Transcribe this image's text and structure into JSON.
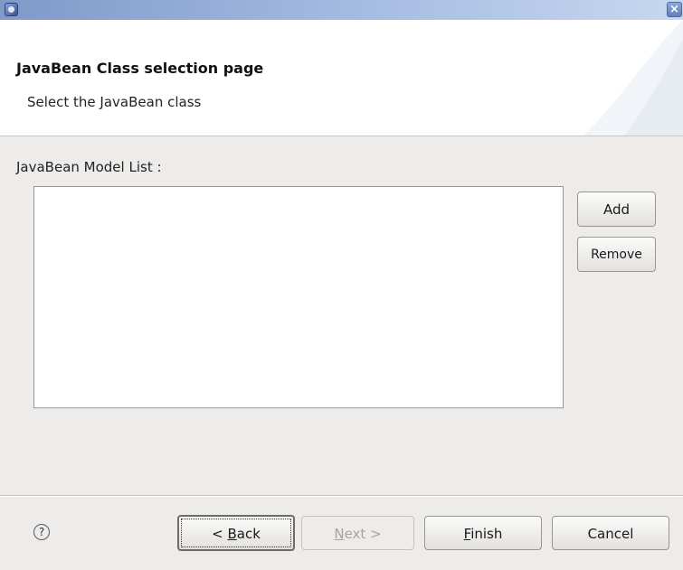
{
  "window": {
    "app_icon": "eclipse-icon",
    "close_icon": "close-icon",
    "close_glyph": "×"
  },
  "header": {
    "title": "JavaBean Class selection page",
    "description": "Select the JavaBean class"
  },
  "main": {
    "list_label": "JavaBean Model List :",
    "list_items": [],
    "buttons": {
      "add": "Add",
      "remove": "Remove"
    }
  },
  "footer": {
    "help_icon": "help-icon",
    "help_glyph": "?",
    "back": {
      "prefix": "< ",
      "mnemonic": "B",
      "rest": "ack"
    },
    "next": {
      "mnemonic": "N",
      "rest": "ext >",
      "enabled": false
    },
    "finish": {
      "mnemonic": "F",
      "rest": "inish"
    },
    "cancel": "Cancel"
  }
}
